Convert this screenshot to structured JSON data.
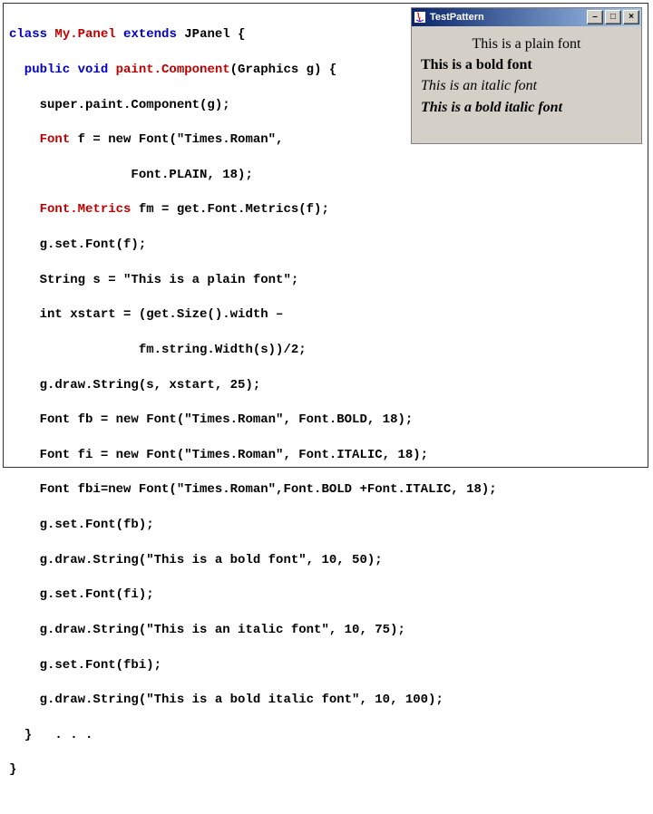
{
  "code": {
    "l01a": "class ",
    "l01b": "My.Panel ",
    "l01c": "extends ",
    "l01d": "JPanel {",
    "l02a": "  public void ",
    "l02b": "paint.Component",
    "l02c": "(Graphics g) {",
    "l03": "    super.paint.Component(g);",
    "l04a": "    ",
    "l04b": "Font ",
    "l04c": "f = new Font(\"Times.Roman\",",
    "l05": "                Font.PLAIN, 18);",
    "l06a": "    ",
    "l06b": "Font.Metrics ",
    "l06c": "fm = get.Font.Metrics(f);",
    "l07": "    g.set.Font(f);",
    "l08": "    String s = \"This is a plain font\";",
    "l09": "    int xstart = (get.Size().width –",
    "l10": "                 fm.string.Width(s))/2;",
    "l11": "    g.draw.String(s, xstart, 25);",
    "l12": "    Font fb = new Font(\"Times.Roman\", Font.BOLD, 18);",
    "l13": "    Font fi = new Font(\"Times.Roman\", Font.ITALIC, 18);",
    "l14": "    Font fbi=new Font(\"Times.Roman\",Font.BOLD +Font.ITALIC, 18);",
    "l15": "    g.set.Font(fb);",
    "l16": "    g.draw.String(\"This is a bold font\", 10, 50);",
    "l17": "    g.set.Font(fi);",
    "l18": "    g.draw.String(\"This is an italic font\", 10, 75);",
    "l19": "    g.set.Font(fbi);",
    "l20": "    g.draw.String(\"This is a bold italic font\", 10, 100);",
    "l21": "  }   . . .",
    "l22": "}"
  },
  "demo_window": {
    "title": "TestPattern",
    "lines": {
      "plain": "This is a plain font",
      "bold": "This is a bold font",
      "italic": "This is an italic font",
      "bold_italic": "This is a bold italic font"
    },
    "buttons": {
      "minimize": "–",
      "maximize": "□",
      "close": "×"
    }
  }
}
